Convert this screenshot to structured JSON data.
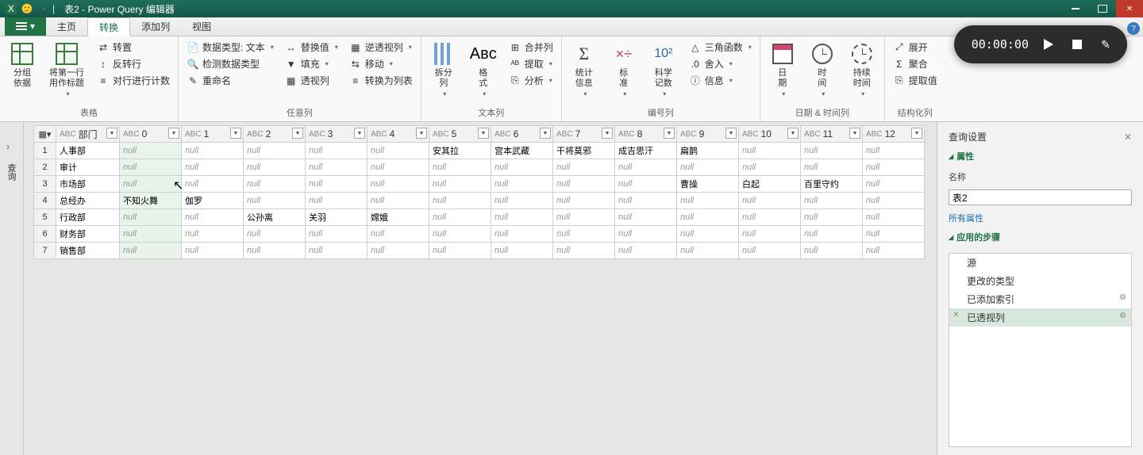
{
  "title": "表2 - Power Query 编辑器",
  "qat_smiley": "🙂",
  "tabs": {
    "file": "文件",
    "home": "主页",
    "transform": "转换",
    "addcol": "添加列",
    "view": "视图"
  },
  "ribbon": {
    "grp_table": {
      "label": "表格",
      "groupby": "分组\n依据",
      "firstrow": "将第一行\n用作标题",
      "transpose": "转置",
      "reverse": "反转行",
      "countrows": "对行进行计数"
    },
    "grp_anycol": {
      "label": "任意列",
      "dtype": "数据类型: 文本",
      "detect": "检测数据类型",
      "rename": "重命名",
      "replace": "替换值",
      "fill": "填充",
      "pivot": "透视列",
      "unpivot": "逆透视列",
      "move": "移动",
      "tolist": "转换为列表"
    },
    "grp_textcol": {
      "label": "文本列",
      "split": "拆分\n列",
      "format": "格\n式",
      "merge": "合并列",
      "extract": "提取",
      "parse": "分析"
    },
    "grp_numcol": {
      "label": "编号列",
      "stats": "统计\n信息",
      "standard": "标\n准",
      "scientific": "科学\n记数",
      "trig": "三角函数",
      "round": "舍入",
      "info": "信息"
    },
    "grp_datetime": {
      "label": "日期 & 时间列",
      "date": "日\n期",
      "time": "时\n间",
      "duration": "持续\n时间"
    },
    "grp_struct": {
      "label": "结构化列",
      "expand": "展开",
      "aggregate": "聚合",
      "extractvals": "提取值"
    }
  },
  "sidebar": {
    "chevron": "›",
    "label": "查询"
  },
  "columns": [
    "部门",
    "0",
    "1",
    "2",
    "3",
    "4",
    "5",
    "6",
    "7",
    "8",
    "9",
    "10",
    "11",
    "12"
  ],
  "col_type_prefix": "ABC",
  "null_text": "null",
  "rows": [
    {
      "n": 1,
      "dept": "人事部",
      "c": [
        null,
        null,
        null,
        null,
        null,
        "安其拉",
        "宫本武藏",
        "干将莫邪",
        "成吉思汗",
        "扁鹊",
        null,
        null,
        null
      ]
    },
    {
      "n": 2,
      "dept": "审计",
      "c": [
        null,
        null,
        null,
        null,
        null,
        null,
        null,
        null,
        null,
        null,
        null,
        null,
        null
      ]
    },
    {
      "n": 3,
      "dept": "市场部",
      "c": [
        null,
        null,
        null,
        null,
        null,
        null,
        null,
        null,
        null,
        "曹操",
        "白起",
        "百里守约",
        null
      ]
    },
    {
      "n": 4,
      "dept": "总经办",
      "c": [
        "不知火舞",
        "伽罗",
        null,
        null,
        null,
        null,
        null,
        null,
        null,
        null,
        null,
        null,
        null
      ]
    },
    {
      "n": 5,
      "dept": "行政部",
      "c": [
        null,
        null,
        "公孙离",
        "关羽",
        "嫦娥",
        null,
        null,
        null,
        null,
        null,
        null,
        null,
        null
      ]
    },
    {
      "n": 6,
      "dept": "财务部",
      "c": [
        null,
        null,
        null,
        null,
        null,
        null,
        null,
        null,
        null,
        null,
        null,
        null,
        null
      ]
    },
    {
      "n": 7,
      "dept": "销售部",
      "c": [
        null,
        null,
        null,
        null,
        null,
        null,
        null,
        null,
        null,
        null,
        null,
        null,
        null
      ]
    }
  ],
  "rpanel": {
    "title": "查询设置",
    "props_section": "属性",
    "name_label": "名称",
    "name_value": "表2",
    "all_props": "所有属性",
    "steps_section": "应用的步骤",
    "steps": [
      "源",
      "更改的类型",
      "已添加索引",
      "已透视列"
    ],
    "selected_step": 3
  },
  "timer": {
    "value": "00:00:00"
  }
}
